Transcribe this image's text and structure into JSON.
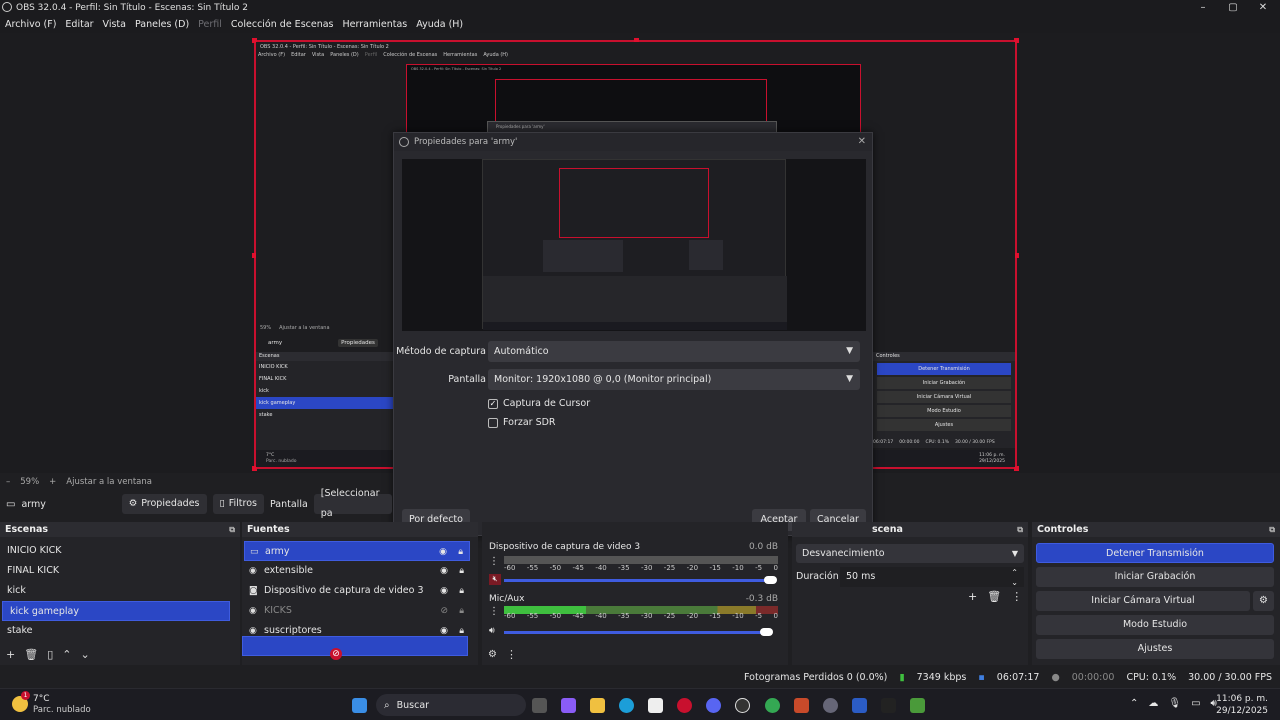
{
  "titlebar": {
    "title": "OBS 32.0.4 - Perfil: Sin Título - Escenas: Sin Título 2",
    "minimize": "–",
    "maximize": "▢",
    "close": "✕"
  },
  "menu": {
    "items": [
      "Archivo (F)",
      "Editar",
      "Vista",
      "Paneles (D)",
      "Perfil",
      "Colección de Escenas",
      "Herramientas",
      "Ayuda (H)"
    ],
    "disabled_index": 4
  },
  "nested_preview": {
    "title": "OBS 32.0.4 - Perfil: Sin Título - Escenas: Sin Título 2",
    "menu": [
      "Archivo (F)",
      "Editar",
      "Vista",
      "Paneles (D)",
      "Perfil",
      "Colección de Escenas",
      "Herramientas",
      "Ayuda (H)"
    ],
    "zoom": "59%",
    "fit": "Ajustar a la ventana",
    "source": "army",
    "props": "Propiedades",
    "scenes_title": "Escenas",
    "scenes": [
      "INICIO KICK",
      "FINAL KICK",
      "kick",
      "kick gameplay",
      "stake"
    ],
    "controls_title": "Controles",
    "controls": [
      "Detener Transmisión",
      "Iniciar Grabación",
      "Iniciar Cámara Virtual",
      "Modo Estudio",
      "Ajustes"
    ],
    "status_time": "06:07:17",
    "status_rec": "00:00:00",
    "status_cpu": "CPU: 0.1%",
    "status_fps": "30.00 / 30.00 FPS",
    "weather": "7°C",
    "weather_desc": "Parc. nublado",
    "clock": "11:06 p. m.",
    "date": "29/12/2025",
    "inner_title": "OBS 32.0.4 - Perfil: Sin Título - Escenas: Sin Título 2",
    "inner_dialog": "Propiedades para 'army'"
  },
  "dialog": {
    "title": "Propiedades para 'army'",
    "capture_method_label": "Método de captura",
    "capture_method_value": "Automático",
    "display_label": "Pantalla",
    "display_value": "Monitor: 1920x1080 @ 0,0 (Monitor principal)",
    "cursor_label": "Captura de Cursor",
    "cursor_checked": true,
    "sdr_label": "Forzar SDR",
    "sdr_checked": false,
    "defaults_btn": "Por defecto",
    "ok_btn": "Aceptar",
    "cancel_btn": "Cancelar"
  },
  "zoom": {
    "minus": "–",
    "value": "59%",
    "plus": "+",
    "fit": "Ajustar a la ventana"
  },
  "source_toolbar": {
    "source_name": "army",
    "properties": "Propiedades",
    "filters": "Filtros",
    "display_label": "Pantalla",
    "display_value": "[Seleccionar pa"
  },
  "scenes": {
    "title": "Escenas",
    "items": [
      "INICIO KICK",
      "FINAL KICK",
      "kick",
      "kick gameplay",
      "stake"
    ],
    "selected": 3
  },
  "sources": {
    "title": "Fuentes",
    "items": [
      {
        "name": "army",
        "icon": "▭",
        "selected": true
      },
      {
        "name": "extensible",
        "icon": "◉",
        "selected": false
      },
      {
        "name": "Dispositivo de captura de video 3",
        "icon": "◙",
        "selected": false
      },
      {
        "name": "KICKS",
        "icon": "◉",
        "selected": false,
        "hidden": true
      },
      {
        "name": "suscriptores",
        "icon": "◉",
        "selected": false
      }
    ]
  },
  "mixer": {
    "channels": [
      {
        "name": "Dispositivo de captura de video 3",
        "db": "0.0 dB"
      },
      {
        "name": "Mic/Aux",
        "db": "-0.3 dB"
      }
    ],
    "ticks": [
      "-60",
      "-55",
      "-50",
      "-45",
      "-40",
      "-35",
      "-30",
      "-25",
      "-20",
      "-15",
      "-10",
      "-5",
      "0"
    ]
  },
  "transitions": {
    "title": "scena",
    "type": "Desvanecimiento",
    "duration_label": "Duración",
    "duration_value": "50 ms"
  },
  "controls": {
    "title": "Controles",
    "buttons": [
      "Detener Transmisión",
      "Iniciar Grabación",
      "Iniciar Cámara Virtual",
      "Modo Estudio",
      "Ajustes"
    ]
  },
  "status": {
    "dropped": "Fotogramas Perdidos 0 (0.0%)",
    "bitrate": "7349 kbps",
    "stream_time": "06:07:17",
    "rec_time": "00:00:00",
    "cpu": "CPU: 0.1%",
    "fps": "30.00 / 30.00 FPS"
  },
  "taskbar": {
    "weather_temp": "7°C",
    "weather_desc": "Parc. nublado",
    "search": "Buscar",
    "time": "11:06 p. m.",
    "date": "29/12/2025",
    "notif_count": "1",
    "colors": {
      "accent": "#2b47c5",
      "red": "#c8102e"
    }
  }
}
